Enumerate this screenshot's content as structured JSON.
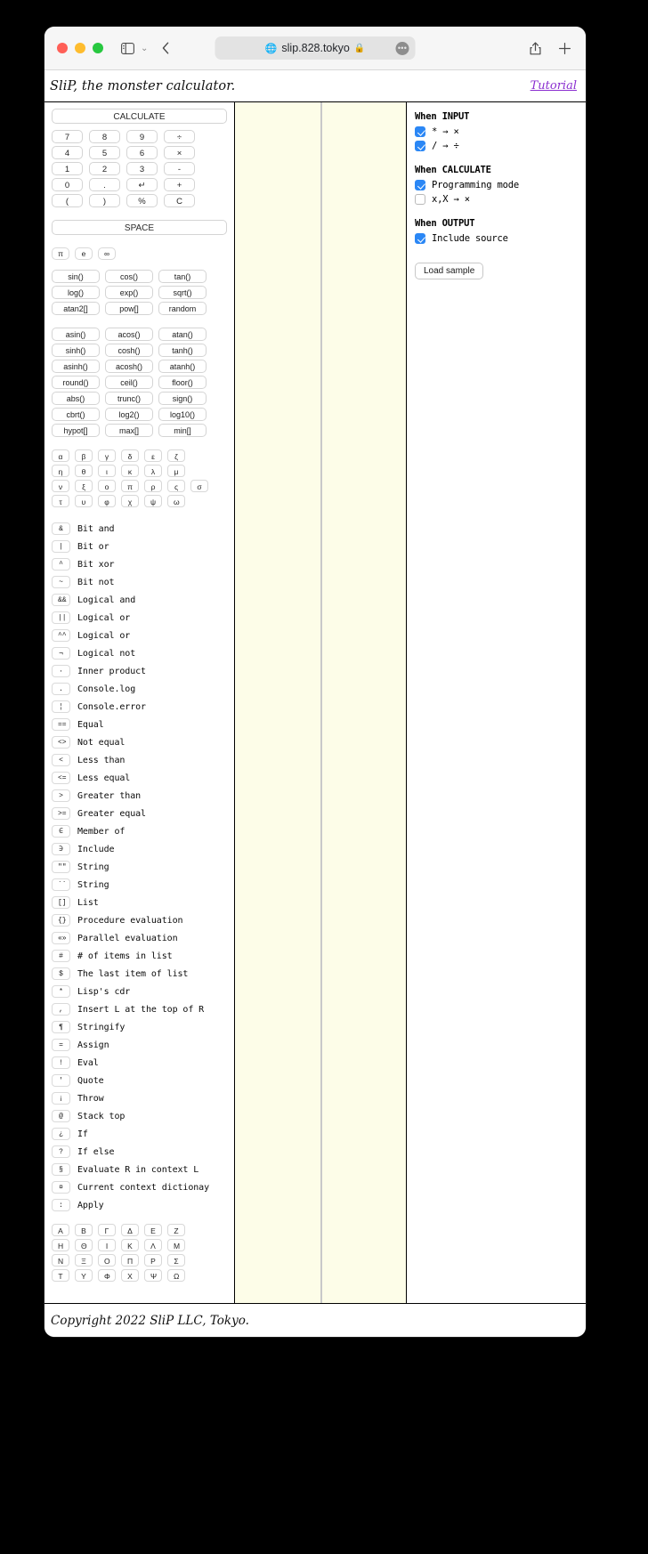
{
  "browser": {
    "url": "slip.828.tokyo",
    "lock_icon": "lock-icon",
    "globe_icon": "globe-icon",
    "more_label": "•••",
    "back_label": "‹",
    "sidebar_icon": "sidebar-icon",
    "chevron_label": "⌄",
    "share_label": "⇧",
    "newtab_label": "+"
  },
  "page": {
    "title": "SliP, the monster calculator.",
    "tutorial": "Tutorial",
    "footer": "Copyright 2022 SliP LLC, Tokyo."
  },
  "keys": {
    "calculate": "CALCULATE",
    "space": "SPACE",
    "numpad": [
      [
        "7",
        "8",
        "9",
        "÷"
      ],
      [
        "4",
        "5",
        "6",
        "×"
      ],
      [
        "1",
        "2",
        "3",
        "-"
      ],
      [
        "0",
        ".",
        "↵",
        "+"
      ],
      [
        "(",
        ")",
        "%",
        "C"
      ]
    ],
    "constants": [
      "π",
      "e",
      "∞"
    ],
    "funcs_a": [
      [
        "sin()",
        "cos()",
        "tan()"
      ],
      [
        "log()",
        "exp()",
        "sqrt()"
      ],
      [
        "atan2[]",
        "pow[]",
        "random"
      ]
    ],
    "funcs_b": [
      [
        "asin()",
        "acos()",
        "atan()"
      ],
      [
        "sinh()",
        "cosh()",
        "tanh()"
      ],
      [
        "asinh()",
        "acosh()",
        "atanh()"
      ],
      [
        "round()",
        "ceil()",
        "floor()"
      ],
      [
        "abs()",
        "trunc()",
        "sign()"
      ],
      [
        "cbrt()",
        "log2()",
        "log10()"
      ],
      [
        "hypot[]",
        "max[]",
        "min[]"
      ]
    ],
    "greek_lower": [
      [
        "α",
        "β",
        "γ",
        "δ",
        "ε",
        "ζ"
      ],
      [
        "η",
        "θ",
        "ι",
        "κ",
        "λ",
        "μ"
      ],
      [
        "ν",
        "ξ",
        "ο",
        "π",
        "ρ",
        "ς",
        "σ"
      ],
      [
        "τ",
        "υ",
        "φ",
        "χ",
        "ψ",
        "ω"
      ]
    ],
    "greek_upper": [
      [
        "Α",
        "Β",
        "Γ",
        "Δ",
        "Ε",
        "Ζ"
      ],
      [
        "Η",
        "Θ",
        "Ι",
        "Κ",
        "Λ",
        "Μ"
      ],
      [
        "Ν",
        "Ξ",
        "Ο",
        "Π",
        "Ρ",
        "Σ"
      ],
      [
        "Τ",
        "Υ",
        "Φ",
        "Χ",
        "Ψ",
        "Ω"
      ]
    ]
  },
  "operators": [
    {
      "sym": "&",
      "desc": "Bit and"
    },
    {
      "sym": "|",
      "desc": "Bit or"
    },
    {
      "sym": "^",
      "desc": "Bit xor"
    },
    {
      "sym": "~",
      "desc": "Bit not"
    },
    {
      "sym": "&&",
      "desc": "Logical and"
    },
    {
      "sym": "||",
      "desc": "Logical or"
    },
    {
      "sym": "^^",
      "desc": "Logical or"
    },
    {
      "sym": "¬",
      "desc": "Logical not"
    },
    {
      "sym": "·",
      "desc": "Inner product"
    },
    {
      "sym": ".",
      "desc": "Console.log"
    },
    {
      "sym": "¦",
      "desc": "Console.error"
    },
    {
      "sym": "==",
      "desc": "Equal"
    },
    {
      "sym": "<>",
      "desc": "Not equal"
    },
    {
      "sym": "<",
      "desc": "Less than"
    },
    {
      "sym": "<=",
      "desc": "Less equal"
    },
    {
      "sym": ">",
      "desc": "Greater than"
    },
    {
      "sym": ">=",
      "desc": "Greater equal"
    },
    {
      "sym": "∈",
      "desc": "Member of"
    },
    {
      "sym": "∋",
      "desc": "Include"
    },
    {
      "sym": "\"\"",
      "desc": "String"
    },
    {
      "sym": "``",
      "desc": "String"
    },
    {
      "sym": "[]",
      "desc": "List"
    },
    {
      "sym": "{}",
      "desc": "Procedure evaluation"
    },
    {
      "sym": "«»",
      "desc": "Parallel evaluation"
    },
    {
      "sym": "#",
      "desc": "# of items in list"
    },
    {
      "sym": "$",
      "desc": "The last item of list"
    },
    {
      "sym": "*",
      "desc": "Lisp's cdr"
    },
    {
      "sym": ",",
      "desc": "Insert L at the top of R"
    },
    {
      "sym": "¶",
      "desc": "Stringify"
    },
    {
      "sym": "=",
      "desc": "Assign"
    },
    {
      "sym": "!",
      "desc": "Eval"
    },
    {
      "sym": "'",
      "desc": "Quote"
    },
    {
      "sym": "¡",
      "desc": "Throw"
    },
    {
      "sym": "@",
      "desc": "Stack top"
    },
    {
      "sym": "¿",
      "desc": "If"
    },
    {
      "sym": "?",
      "desc": "If else"
    },
    {
      "sym": "§",
      "desc": "Evaluate R in context L"
    },
    {
      "sym": "¤",
      "desc": "Current context dictionay"
    },
    {
      "sym": ":",
      "desc": "Apply"
    }
  ],
  "settings": {
    "groups": [
      {
        "head": "When INPUT",
        "rows": [
          {
            "label": "* → ×",
            "checked": true
          },
          {
            "label": "/ → ÷",
            "checked": true
          }
        ]
      },
      {
        "head": "When CALCULATE",
        "rows": [
          {
            "label": "Programming mode",
            "checked": true
          },
          {
            "label": "x,X → ×",
            "checked": false
          }
        ]
      },
      {
        "head": "When OUTPUT",
        "rows": [
          {
            "label": "Include source",
            "checked": true
          }
        ]
      }
    ],
    "load_sample": "Load sample"
  },
  "colors": {
    "accent": "#2b87f5",
    "link": "#8b2fd0",
    "panel_bg": "#fdfde8"
  }
}
